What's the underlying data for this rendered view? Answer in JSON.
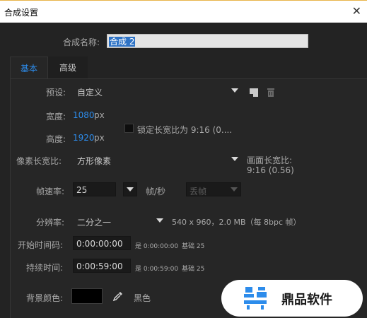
{
  "window": {
    "title": "合成设置",
    "close_glyph": "✕"
  },
  "comp_name": {
    "label": "合成名称:",
    "value": "合成 2"
  },
  "tabs": [
    {
      "label": "基本",
      "active": true
    },
    {
      "label": "高级",
      "active": false
    }
  ],
  "basic": {
    "preset": {
      "label": "预设:",
      "value": "自定义",
      "save_icon": "save-preset-icon",
      "delete_icon": "trash-icon"
    },
    "width": {
      "label": "宽度:",
      "value": "1080",
      "unit": "px"
    },
    "height": {
      "label": "高度:",
      "value": "1920",
      "unit": "px"
    },
    "lock_ratio": {
      "label": "锁定长宽比为 9:16 (0....",
      "checked": false
    },
    "pixel_aspect": {
      "label": "像素长宽比:",
      "value": "方形像素"
    },
    "frame_aspect": {
      "label": "画面长宽比:",
      "value": "9:16 (0.56)"
    },
    "frame_rate": {
      "label": "帧速率:",
      "value": "25",
      "unit": "帧/秒",
      "drop_frame": "丢帧"
    },
    "resolution": {
      "label": "分辨率:",
      "value": "二分之一",
      "info": "540 x 960，2.0 MB（每 8bpc 帧）"
    },
    "start_timecode": {
      "label": "开始时间码:",
      "value": "0:00:00:00",
      "is_text": "是 0:00:00:00",
      "base_text": "基础 25"
    },
    "duration": {
      "label": "持续时间:",
      "value": "0:00:59:00",
      "is_text": "是 0:00:59:00",
      "base_text": "基础 25"
    },
    "background": {
      "label": "背景颜色:",
      "color_name": "黑色",
      "color": "#000000"
    }
  },
  "watermark": {
    "brand": "鼎品软件"
  },
  "colors": {
    "accent": "#2d8ceb",
    "selection": "#2e73c6",
    "panel": "#262626",
    "background": "#232323"
  }
}
